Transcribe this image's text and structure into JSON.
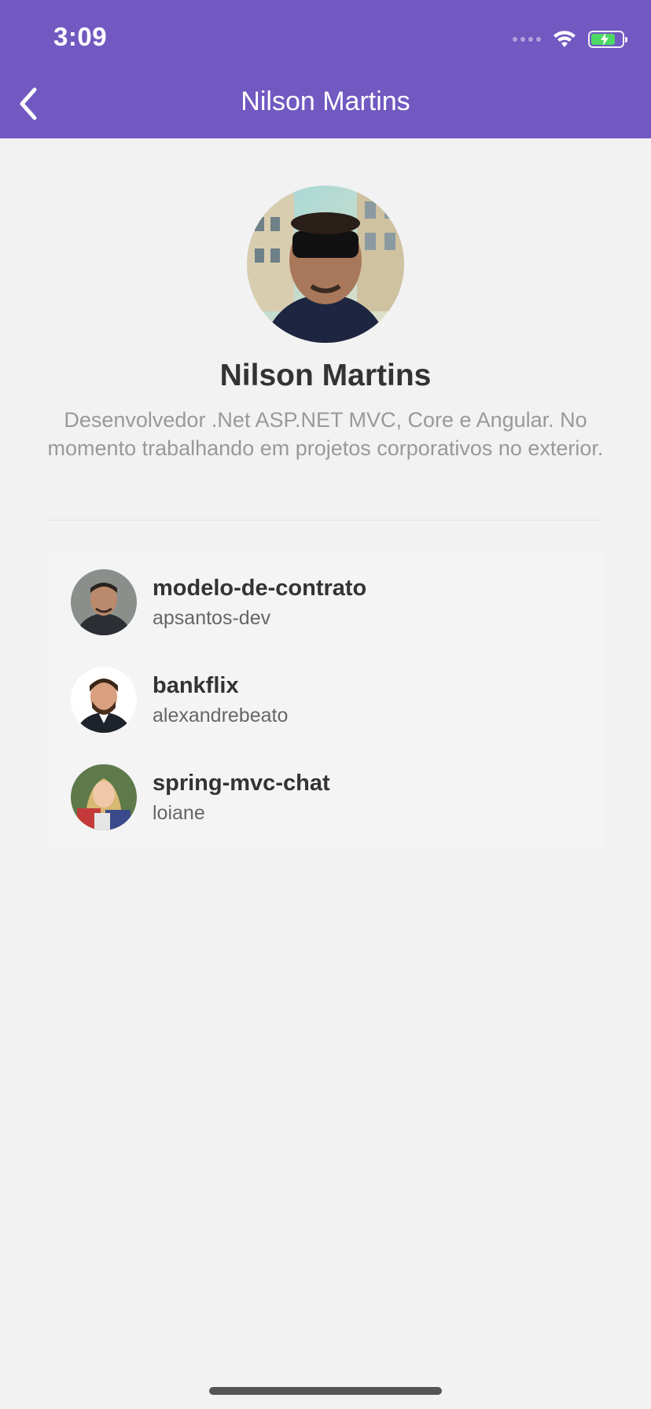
{
  "status_bar": {
    "time": "3:09",
    "battery_level": 0.8
  },
  "nav": {
    "title": "Nilson Martins",
    "back_icon": "chevron-left-icon"
  },
  "profile": {
    "name": "Nilson Martins",
    "bio": "Desenvolvedor .Net ASP.NET MVC, Core e Angular. No momento trabalhando em projetos corporativos no exterior."
  },
  "repositories": [
    {
      "title": "modelo-de-contrato",
      "owner": "apsantos-dev"
    },
    {
      "title": "bankflix",
      "owner": "alexandrebeato"
    },
    {
      "title": "spring-mvc-chat",
      "owner": "loiane"
    }
  ],
  "colors": {
    "header": "#7159c1",
    "background": "#f2f2f2",
    "title_text": "#333333",
    "muted_text": "#999999",
    "battery": "#4cd964"
  }
}
